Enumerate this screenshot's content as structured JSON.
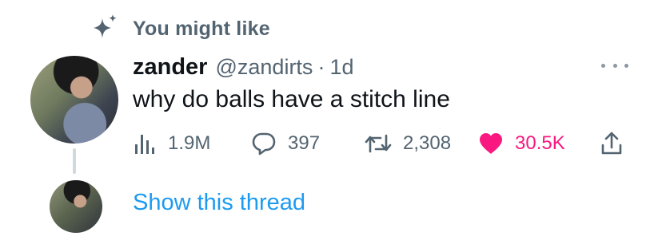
{
  "context": {
    "label": "You might like",
    "icon": "sparkle-icon"
  },
  "tweet": {
    "display_name": "zander",
    "handle": "@zandirts",
    "separator": "·",
    "timestamp": "1d",
    "text": "why do balls have a stitch line",
    "metrics": {
      "views": "1.9M",
      "replies": "397",
      "retweets": "2,308",
      "likes": "30.5K"
    },
    "liked": true
  },
  "thread": {
    "show_label": "Show this thread"
  },
  "colors": {
    "secondary_text": "#536471",
    "link": "#1d9bf0",
    "like": "#f91880",
    "thread_line": "#cfd9de"
  }
}
